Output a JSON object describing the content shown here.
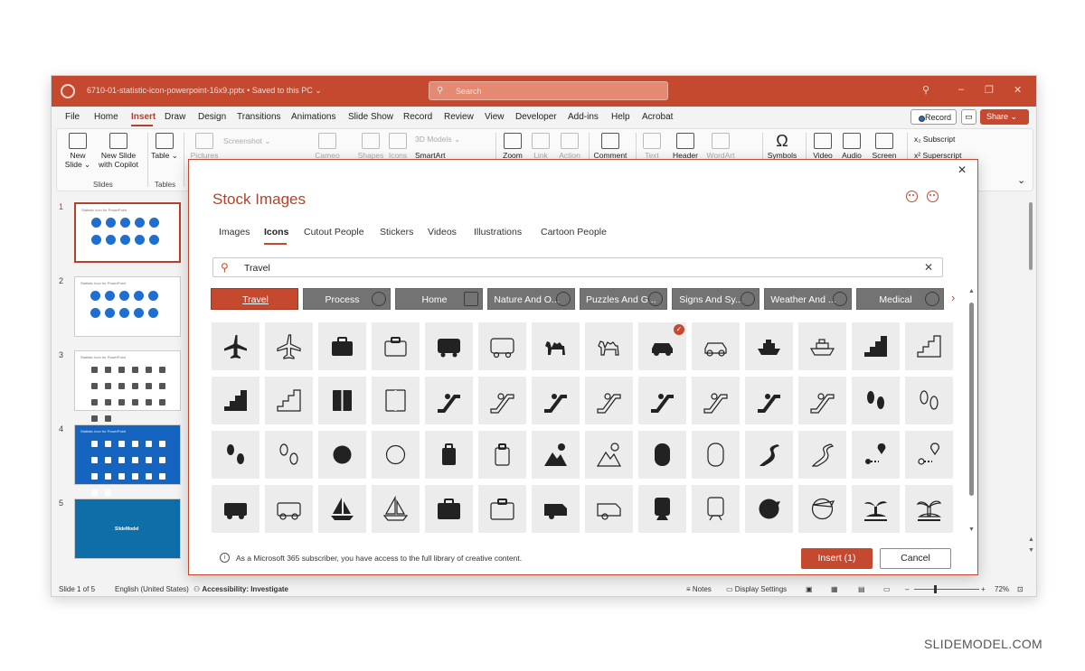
{
  "window": {
    "file_title": "6710-01-statistic-icon-powerpoint-16x9.pptx  •  Saved to this PC ⌄",
    "search_placeholder": "Search",
    "search_icon": "search-icon",
    "controls": [
      "⚲",
      "–",
      "❐",
      "✕"
    ]
  },
  "menu": {
    "items": [
      "File",
      "Home",
      "Insert",
      "Draw",
      "Design",
      "Transitions",
      "Animations",
      "Slide Show",
      "Record",
      "Review",
      "View",
      "Developer",
      "Add-ins",
      "Help",
      "Acrobat"
    ],
    "active": "Insert",
    "record_label": "Record",
    "share_label": "Share ⌄",
    "comment_icon": "comment-icon"
  },
  "ribbon": {
    "new_slide": "New Slide ⌄",
    "new_slide_copilot": "New Slide with Copilot",
    "table": "Table ⌄",
    "pictures": "Pictures",
    "screenshot": "Screenshot ⌄",
    "cameo": "Cameo",
    "shapes": "Shapes",
    "icons": "Icons",
    "models_3d": "3D Models ⌄",
    "smartart": "SmartArt",
    "zoom": "Zoom",
    "link": "Link",
    "action": "Action",
    "comment": "Comment",
    "text": "Text",
    "header": "Header",
    "wordart": "WordArt",
    "symbols": "Symbols",
    "video": "Video",
    "audio": "Audio",
    "screen": "Screen",
    "subscript": "Subscript",
    "superscript": "Superscript",
    "group_slides": "Slides",
    "group_tables": "Tables",
    "collapse": "⌄"
  },
  "thumbnails": [
    {
      "number": "1",
      "title": "Statistic Icon for PowerPoint"
    },
    {
      "number": "2",
      "title": "Statistic Icon for PowerPoint"
    },
    {
      "number": "3",
      "title": "Statistic Icon for PowerPoint"
    },
    {
      "number": "4",
      "title": "Statistic Icon for PowerPoint"
    },
    {
      "number": "5",
      "title": "SlideModel"
    }
  ],
  "status": {
    "slide": "Slide 1 of 5",
    "language": "English (United States)",
    "accessibility": "Accessibility: Investigate",
    "notes": "Notes",
    "display": "Display Settings",
    "zoom": "72%",
    "zoom_minus": "–",
    "zoom_plus": "+"
  },
  "dialog": {
    "title": "Stock Images",
    "close": "✕",
    "tabs": [
      "Images",
      "Icons",
      "Cutout People",
      "Stickers",
      "Videos",
      "Illustrations",
      "Cartoon People"
    ],
    "active_tab": "Icons",
    "search_value": "Travel",
    "search_icon": "search-icon",
    "clear_icon": "close-icon",
    "categories": [
      "Travel",
      "Process",
      "Home",
      "Nature And O...",
      "Puzzles And G...",
      "Signs And Sy...",
      "Weather And ...",
      "Medical"
    ],
    "selected_category": "Travel",
    "next_arrow": "›",
    "info": "As a Microsoft 365 subscriber, you have access to the full library of creative content.",
    "insert_label": "Insert (1)",
    "cancel_label": "Cancel",
    "selected_badge": "✓",
    "icons": [
      [
        "airplane-icon",
        "airplane-outline-icon",
        "briefcase-icon",
        "briefcase-outline-icon",
        "bus-icon",
        "bus-outline-icon",
        "camel-icon",
        "camel-outline-icon",
        "car-icon",
        "car-outline-icon",
        "cruise-ship-icon",
        "cruise-ship-outline-icon",
        "stairs-down-icon",
        "stairs-down-outline-icon"
      ],
      [
        "stairs-down-2-icon",
        "stairs-down-2-outline-icon",
        "elevator-icon",
        "elevator-outline-icon",
        "escalator-up-icon",
        "escalator-up-outline-icon",
        "escalator-down-icon",
        "escalator-down-outline-icon",
        "escalator-up-2-icon",
        "escalator-up-2-outline-icon",
        "escalator-down-2-icon",
        "escalator-down-2-outline-icon",
        "footprints-icon",
        "footprints-outline-icon"
      ],
      [
        "shoe-prints-icon",
        "shoe-prints-outline-icon",
        "hot-air-balloon-icon",
        "hot-air-balloon-outline-icon",
        "luggage-icon",
        "luggage-outline-icon",
        "mountain-balloon-icon",
        "mountain-balloon-outline-icon",
        "airplane-window-icon",
        "airplane-window-outline-icon",
        "road-trees-icon",
        "road-trees-outline-icon",
        "route-pin-icon",
        "route-pin-outline-icon"
      ],
      [
        "rv-icon",
        "rv-outline-icon",
        "sailboat-icon",
        "sailboat-outline-icon",
        "suitcase-icon",
        "suitcase-outline-icon",
        "camper-trailer-icon",
        "camper-trailer-outline-icon",
        "train-icon",
        "train-outline-icon",
        "globe-plane-icon",
        "globe-plane-outline-icon",
        "island-icon",
        "island-outline-icon"
      ]
    ]
  },
  "watermark": "SLIDEMODEL.COM",
  "colors": {
    "accent": "#c4492f",
    "tile": "#ececec",
    "category": "#737373"
  }
}
